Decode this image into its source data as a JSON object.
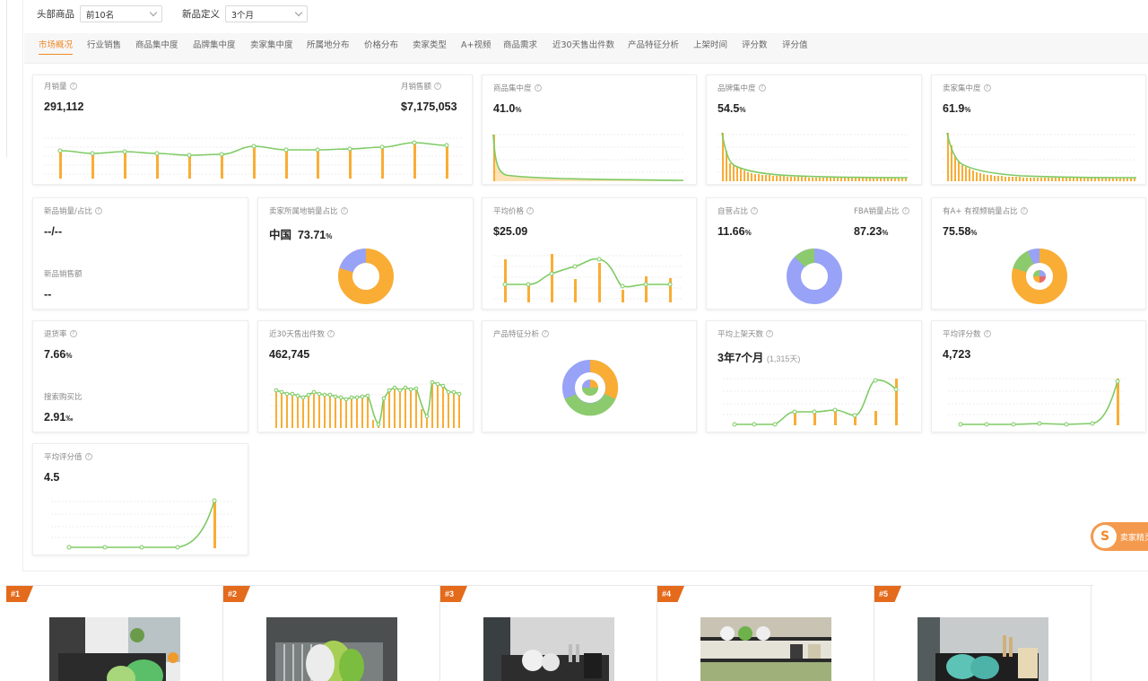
{
  "filters": {
    "top_label": "头部商品",
    "top_value": "前10名",
    "new_label": "新品定义",
    "new_value": "3个月"
  },
  "tabs": [
    "市场概况",
    "行业销售",
    "商品集中度",
    "品牌集中度",
    "卖家集中度",
    "所属地分布",
    "价格分布",
    "卖家类型",
    "A+视频",
    "商品需求",
    "近30天售出件数",
    "产品特征分析",
    "上架时间",
    "评分数",
    "评分值"
  ],
  "colors": {
    "accent": "#f0892b",
    "bar": "#f9ad35",
    "line": "#7ecb64",
    "blue": "#98a2f7",
    "green": "#8ccb6d",
    "orange": "#f9ad35"
  },
  "cards": {
    "monthly": {
      "label": "月销量",
      "value": "291,112",
      "label2": "月销售额",
      "value2": "$7,175,053"
    },
    "product_conc": {
      "label": "商品集中度",
      "value": "41.0",
      "unit": "%"
    },
    "brand_conc": {
      "label": "品牌集中度",
      "value": "54.5",
      "unit": "%"
    },
    "seller_conc": {
      "label": "卖家集中度",
      "value": "61.9",
      "unit": "%"
    },
    "new_products": {
      "label": "新品销量/占比",
      "value": "--/--",
      "label2": "新品销售额",
      "value2": "--"
    },
    "seller_origin": {
      "label": "卖家所属地销量占比",
      "country": "中国",
      "value": "73.71",
      "unit": "%"
    },
    "avg_price": {
      "label": "平均价格",
      "value": "$25.09"
    },
    "self_op": {
      "label": "自营占比",
      "value": "11.66",
      "unit": "%",
      "label2": "FBA销量占比",
      "value2": "87.23",
      "unit2": "%"
    },
    "aplus": {
      "label": "有A+ 有视频销量占比",
      "value": "75.58",
      "unit": "%"
    },
    "return_rate": {
      "label": "退货率",
      "value": "7.66",
      "unit": "%",
      "label2": "搜索购买比",
      "value2": "2.91",
      "unit2": "‰"
    },
    "sold30": {
      "label": "近30天售出件数",
      "value": "462,745"
    },
    "features": {
      "label": "产品特征分析"
    },
    "listing_days": {
      "label": "平均上架天数",
      "value": "3年7个月",
      "sub": "(1,315天)"
    },
    "review_count": {
      "label": "平均评分数",
      "value": "4,723"
    },
    "avg_rating": {
      "label": "平均评分值",
      "value": "4.5"
    }
  },
  "products": [
    "#1",
    "#2",
    "#3",
    "#4",
    "#5"
  ],
  "float_button": {
    "text": "卖家精灵"
  }
}
